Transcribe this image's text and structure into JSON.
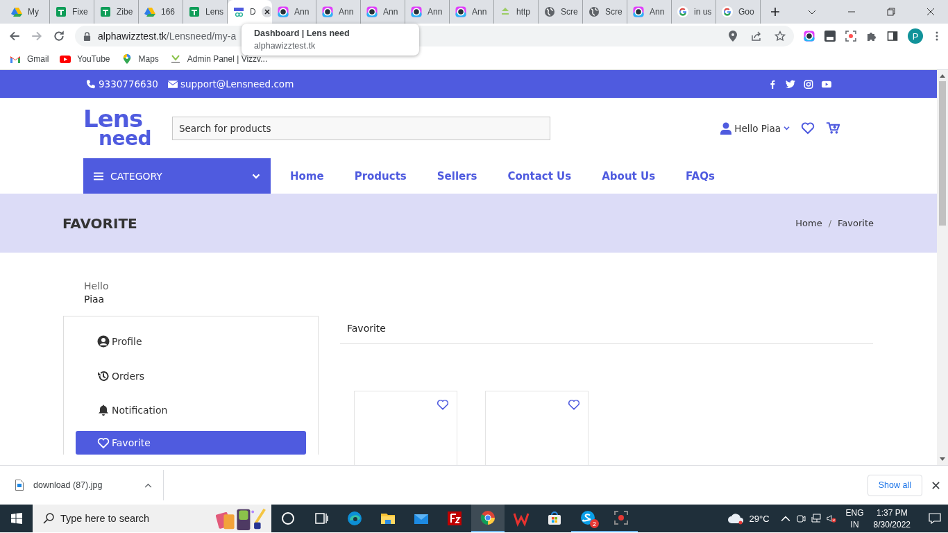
{
  "browser": {
    "tabs": [
      {
        "kind": "drive",
        "label": "My",
        "selected": false
      },
      {
        "kind": "sheets",
        "label": "Fixe",
        "selected": false
      },
      {
        "kind": "sheets",
        "label": "Zibe",
        "selected": false
      },
      {
        "kind": "drive",
        "label": "166",
        "selected": false
      },
      {
        "kind": "sheets",
        "label": "Lens",
        "selected": false
      },
      {
        "kind": "lens",
        "label": "D",
        "selected": true
      },
      {
        "kind": "annotate",
        "label": "Ann",
        "selected": false
      },
      {
        "kind": "annotate",
        "label": "Ann",
        "selected": false
      },
      {
        "kind": "annotate",
        "label": "Ann",
        "selected": false
      },
      {
        "kind": "annotate",
        "label": "Ann",
        "selected": false
      },
      {
        "kind": "annotate",
        "label": "Ann",
        "selected": false
      },
      {
        "kind": "site",
        "label": "http",
        "selected": false
      },
      {
        "kind": "globe",
        "label": "Scre",
        "selected": false
      },
      {
        "kind": "globe",
        "label": "Scre",
        "selected": false
      },
      {
        "kind": "annotate",
        "label": "Ann",
        "selected": false
      },
      {
        "kind": "google",
        "label": "in us",
        "selected": false
      },
      {
        "kind": "google",
        "label": "Goo",
        "selected": false
      }
    ],
    "address": {
      "host": "alphawizztest.tk",
      "path": "/Lensneed/my-a"
    },
    "tooltip": {
      "title": "Dashboard | Lens need",
      "url": "alphawizztest.tk"
    },
    "profile_initial": "P",
    "bookmarks": [
      {
        "kind": "gmail",
        "label": "Gmail"
      },
      {
        "kind": "youtube",
        "label": "YouTube"
      },
      {
        "kind": "maps",
        "label": "Maps"
      },
      {
        "kind": "admin",
        "label": "Admin Panel | Vizzv..."
      }
    ]
  },
  "site": {
    "topbar": {
      "phone": "9330776630",
      "email": "support@Lensneed.com"
    },
    "logo": {
      "top": "Lens",
      "bottom": "need"
    },
    "search": {
      "placeholder": "Search for products"
    },
    "greeting": "Hello Piaa",
    "category": "CATEGORY",
    "nav": [
      "Home",
      "Products",
      "Sellers",
      "Contact Us",
      "About Us",
      "FAQs"
    ],
    "page_title": "FAVORITE",
    "breadcrumb": [
      "Home",
      "Favorite"
    ],
    "breadcrumb_separator": "/",
    "hello": "Hello",
    "user": "Piaa",
    "menu": [
      {
        "kind": "user",
        "label": "Profile",
        "selected": false
      },
      {
        "kind": "history",
        "label": "Orders",
        "selected": false
      },
      {
        "kind": "bell",
        "label": "Notification",
        "selected": false
      },
      {
        "kind": "heart",
        "label": "Favorite",
        "selected": true
      }
    ],
    "section_title": "Favorite",
    "products": [
      {
        "favorite": false
      },
      {
        "favorite": false
      }
    ]
  },
  "downloads": {
    "file": "download (87).jpg",
    "show_all": "Show all"
  },
  "taskbar": {
    "search_placeholder": "Type here to search",
    "apps": [
      {
        "kind": "cortana",
        "selected": false,
        "running": false
      },
      {
        "kind": "taskview",
        "selected": false,
        "running": false
      },
      {
        "kind": "edge",
        "selected": false,
        "running": false
      },
      {
        "kind": "explorer",
        "selected": false,
        "running": false
      },
      {
        "kind": "mail",
        "selected": false,
        "running": false
      },
      {
        "kind": "filezilla",
        "selected": false,
        "running": false
      },
      {
        "kind": "chrome",
        "selected": true,
        "running": true
      },
      {
        "kind": "wps",
        "selected": false,
        "running": false
      },
      {
        "kind": "store",
        "selected": false,
        "running": false
      },
      {
        "kind": "skype",
        "selected": false,
        "running": true,
        "badge": "2"
      },
      {
        "kind": "recorder",
        "selected": false,
        "running": true
      }
    ],
    "weather": "29°C",
    "lang": "ENG",
    "region": "IN",
    "time": "1:37 PM",
    "date": "8/30/2022"
  }
}
